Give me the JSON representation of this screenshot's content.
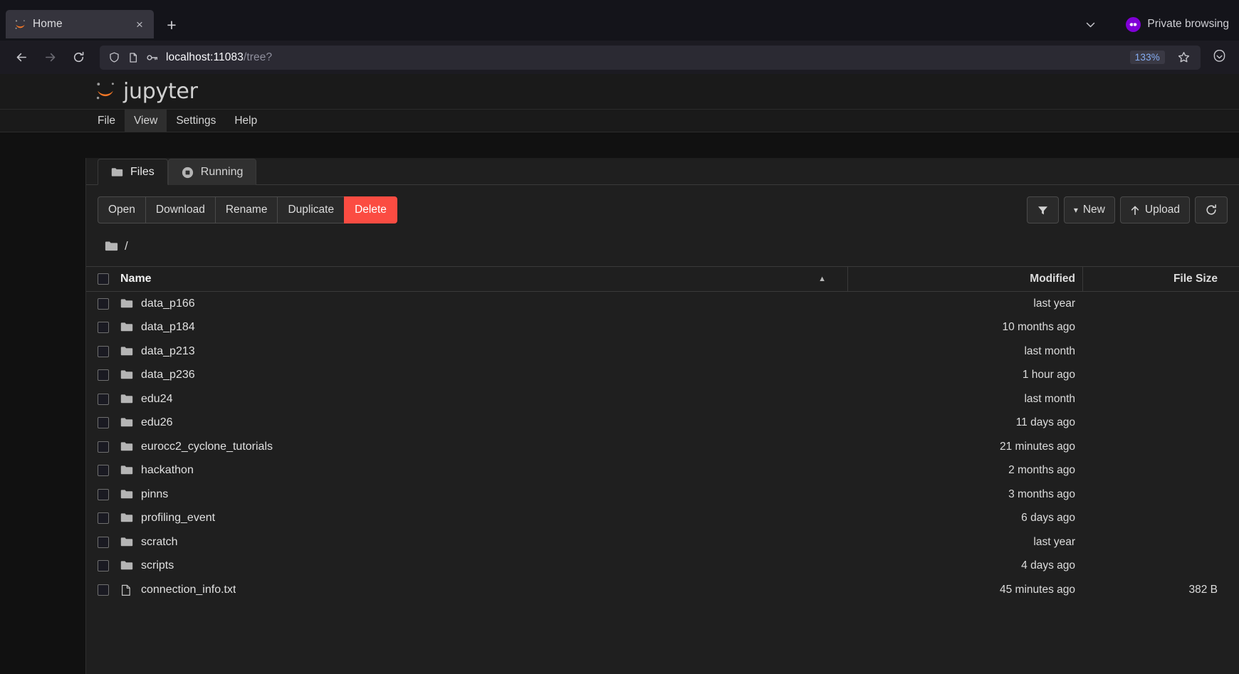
{
  "browser": {
    "tab": {
      "title": "Home",
      "favicon": "jupyter-favicon",
      "close_label": "×"
    },
    "new_tab_label": "+",
    "list_all_tabs": "chevron-down-icon",
    "private_browsing_label": "Private browsing",
    "nav": {
      "back": "back-arrow-icon",
      "forward": "forward-arrow-icon",
      "reload": "reload-icon"
    },
    "urlbar": {
      "shield": "shield-icon",
      "page_icon": "page-icon",
      "permission_icon": "key-icon",
      "host": "localhost:11083",
      "path": "/tree?",
      "zoom_level": "133%",
      "bookmark": "star-icon",
      "pocket": "save-to-pocket-icon"
    }
  },
  "jupyter": {
    "brand": "jupyter",
    "menus": [
      {
        "label": "File",
        "active": false
      },
      {
        "label": "View",
        "active": true
      },
      {
        "label": "Settings",
        "active": false
      },
      {
        "label": "Help",
        "active": false
      }
    ],
    "tabs": [
      {
        "label": "Files",
        "icon": "folder-icon",
        "active": true
      },
      {
        "label": "Running",
        "icon": "stop-circle-icon",
        "active": false
      }
    ],
    "toolbar": {
      "actions": [
        {
          "label": "Open",
          "style": "normal"
        },
        {
          "label": "Download",
          "style": "normal"
        },
        {
          "label": "Rename",
          "style": "normal"
        },
        {
          "label": "Duplicate",
          "style": "normal"
        },
        {
          "label": "Delete",
          "style": "danger"
        }
      ],
      "filter_icon": "filter-funnel-icon",
      "new_label": "New",
      "new_caret": "▾",
      "upload_label": "Upload",
      "upload_icon": "upload-arrow-icon",
      "refresh_icon": "refresh-icon"
    },
    "breadcrumb": {
      "icon": "folder-icon",
      "path": "/"
    },
    "table": {
      "columns": {
        "name": "Name",
        "modified": "Modified",
        "size": "File Size"
      },
      "sort_indicator": "▲",
      "rows": [
        {
          "name": "data_p166",
          "type": "folder",
          "modified": "last year",
          "size": ""
        },
        {
          "name": "data_p184",
          "type": "folder",
          "modified": "10 months ago",
          "size": ""
        },
        {
          "name": "data_p213",
          "type": "folder",
          "modified": "last month",
          "size": ""
        },
        {
          "name": "data_p236",
          "type": "folder",
          "modified": "1 hour ago",
          "size": ""
        },
        {
          "name": "edu24",
          "type": "folder",
          "modified": "last month",
          "size": ""
        },
        {
          "name": "edu26",
          "type": "folder",
          "modified": "11 days ago",
          "size": ""
        },
        {
          "name": "eurocc2_cyclone_tutorials",
          "type": "folder",
          "modified": "21 minutes ago",
          "size": ""
        },
        {
          "name": "hackathon",
          "type": "folder",
          "modified": "2 months ago",
          "size": ""
        },
        {
          "name": "pinns",
          "type": "folder",
          "modified": "3 months ago",
          "size": ""
        },
        {
          "name": "profiling_event",
          "type": "folder",
          "modified": "6 days ago",
          "size": ""
        },
        {
          "name": "scratch",
          "type": "folder",
          "modified": "last year",
          "size": ""
        },
        {
          "name": "scripts",
          "type": "folder",
          "modified": "4 days ago",
          "size": ""
        },
        {
          "name": "connection_info.txt",
          "type": "file",
          "modified": "45 minutes ago",
          "size": "382 B"
        }
      ]
    }
  },
  "colors": {
    "jupyter_orange": "#f37726",
    "delete_red": "#fb4c42",
    "private_purple": "#8000d7",
    "panel_bg": "#1f1f1f"
  }
}
